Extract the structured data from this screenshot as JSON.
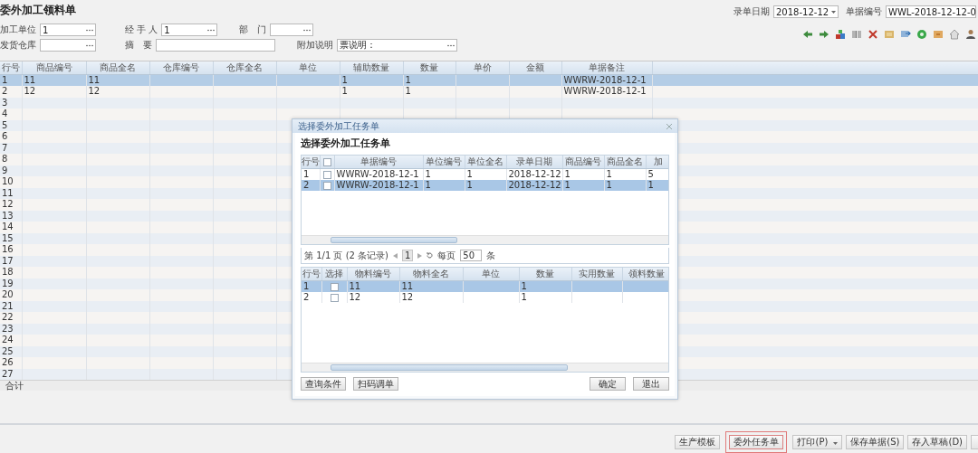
{
  "title": "委外加工领料单",
  "form_rows": [
    [
      {
        "label": "加工单位",
        "value": "1",
        "kind": "lookup"
      },
      {
        "label": "经 手 人",
        "value": "1",
        "kind": "lookup"
      },
      {
        "label": "部　门",
        "kind": "lookup"
      }
    ],
    [
      {
        "label": "发货仓库",
        "kind": "lookup"
      },
      {
        "label": "摘　要",
        "kind": "text"
      },
      {
        "label": "附加说明",
        "value": "票说明：",
        "kind": "lookup"
      }
    ]
  ],
  "date_field": {
    "label": "录单日期",
    "value": "2018-12-12"
  },
  "number_field": {
    "label": "单据编号",
    "value": "WWL-2018-12-12-0"
  },
  "grid": {
    "columns": [
      "行号",
      "商品编号",
      "商品全名",
      "仓库编号",
      "仓库全名",
      "单位",
      "辅助数量",
      "数量",
      "单价",
      "金额",
      "单据备注"
    ],
    "rows": [
      {
        "number": "1",
        "selected": true,
        "product_code": "11",
        "product_name": "11",
        "aux_qty": "1",
        "qty": "1",
        "note": "WWRW-2018-12-1"
      },
      {
        "number": "2",
        "selected": false,
        "product_code": "12",
        "product_name": "12",
        "aux_qty": "1",
        "qty": "1",
        "note": "WWRW-2018-12-1"
      },
      {
        "number": "3",
        "selected": false
      },
      {
        "number": "4",
        "selected": false
      },
      {
        "number": "5",
        "selected": false
      },
      {
        "number": "6",
        "selected": false
      },
      {
        "number": "7",
        "selected": false
      },
      {
        "number": "8",
        "selected": false
      },
      {
        "number": "9",
        "selected": false
      },
      {
        "number": "10",
        "selected": false
      },
      {
        "number": "11",
        "selected": false
      },
      {
        "number": "12",
        "selected": false
      },
      {
        "number": "13",
        "selected": false
      },
      {
        "number": "14",
        "selected": false
      },
      {
        "number": "15",
        "selected": false
      },
      {
        "number": "16",
        "selected": false
      },
      {
        "number": "17",
        "selected": false
      },
      {
        "number": "18",
        "selected": false
      },
      {
        "number": "19",
        "selected": false
      },
      {
        "number": "20",
        "selected": false
      },
      {
        "number": "21",
        "selected": false
      },
      {
        "number": "22",
        "selected": false
      },
      {
        "number": "23",
        "selected": false
      },
      {
        "number": "24",
        "selected": false
      },
      {
        "number": "25",
        "selected": false
      },
      {
        "number": "26",
        "selected": false
      },
      {
        "number": "27",
        "selected": false
      }
    ],
    "total_label": "合计"
  },
  "dialog": {
    "title": "选择委外加工任务单",
    "heading": "选择委外加工任务单",
    "task_table": {
      "columns": [
        "行号",
        "单据编号",
        "单位编号",
        "单位全名",
        "录单日期",
        "商品编号",
        "商品全名",
        "加"
      ],
      "header_checked": false,
      "rows": [
        {
          "number": "1",
          "checked": false,
          "selected": false,
          "doc_no": "WWRW-2018-12-1",
          "unit_code": "1",
          "unit_name": "1",
          "date": "2018-12-12",
          "product_code": "1",
          "product_name": "1",
          "column_9": "5"
        },
        {
          "number": "2",
          "checked": false,
          "selected": true,
          "doc_no": "WWRW-2018-12-1",
          "unit_code": "1",
          "unit_name": "1",
          "date": "2018-12-12",
          "product_code": "1",
          "product_name": "1",
          "column_9": "1"
        }
      ]
    },
    "pager": {
      "info": "第 1/1 页 (2 条记录)",
      "page": "1",
      "per_page_label": "每页",
      "per_page": "50",
      "unit": "条"
    },
    "material_table": {
      "columns": [
        "行号",
        "选择",
        "物料编号",
        "物料全名",
        "单位",
        "数量",
        "实用数量",
        "领料数量"
      ],
      "rows": [
        {
          "number": "1",
          "checked": false,
          "selected": true,
          "code": "11",
          "name": "11",
          "qty": "1"
        },
        {
          "number": "2",
          "checked": false,
          "selected": false,
          "code": "12",
          "name": "12",
          "qty": "1"
        }
      ]
    },
    "left_buttons": [
      "查询条件",
      "扫码调单"
    ],
    "right_buttons": [
      "确定",
      "退出"
    ]
  },
  "bottom_buttons": [
    {
      "label": "生产模板",
      "kind": "button",
      "highlighted": false
    },
    {
      "label": "委外任务单",
      "kind": "button",
      "highlighted": true
    },
    {
      "label": "打印(P)",
      "kind": "menu",
      "highlighted": false
    },
    {
      "label": "保存单据(S)",
      "kind": "button",
      "highlighted": false
    },
    {
      "label": "存入草稿(D)",
      "kind": "button",
      "highlighted": false
    }
  ]
}
